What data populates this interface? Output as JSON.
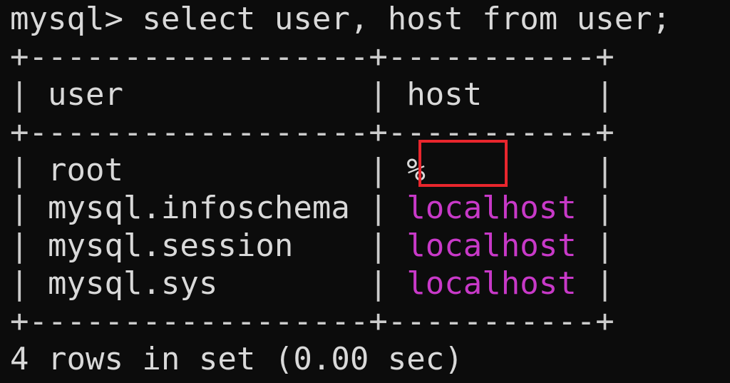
{
  "terminal": {
    "command_line": "mysql> select user, host from user;",
    "separator": "+------------------+-----------+",
    "header": {
      "user": "user",
      "host": "host"
    },
    "rows": [
      {
        "user": "root",
        "host": "%"
      },
      {
        "user": "mysql.infoschema",
        "host": "localhost"
      },
      {
        "user": "mysql.session",
        "host": "localhost"
      },
      {
        "user": "mysql.sys",
        "host": "localhost"
      }
    ],
    "result_summary": "4 rows in set (0.00 sec)",
    "colors": {
      "background": "#0c0c0c",
      "text": "#d9d9d9",
      "host_localhost": "#c839c8",
      "highlight_box": "#e8262d"
    }
  }
}
